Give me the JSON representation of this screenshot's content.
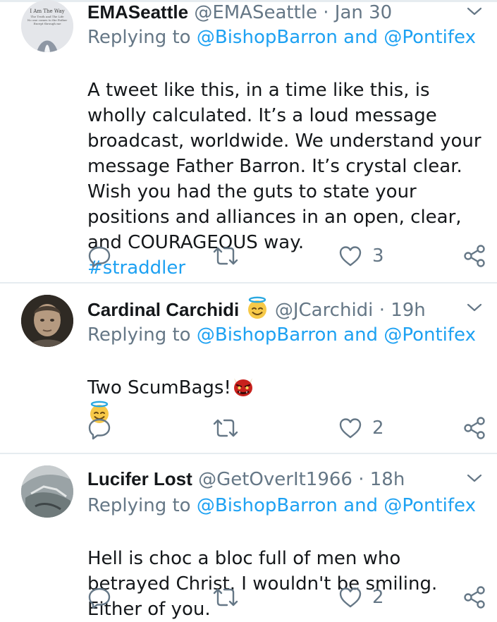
{
  "reply_prefix": "Replying to",
  "mentions": [
    "@BishopBarron",
    "@Pontifex"
  ],
  "conjunction": "and",
  "tweets": [
    {
      "name": "EMASeattle",
      "handle": "@EMASeattle",
      "separator": "·",
      "time": "Jan 30",
      "avatar_text": [
        "I Am The Way",
        "The Truth and The Life",
        "No one comes to the Father",
        "Except through me"
      ],
      "body": "A tweet like this, in a time like this, is wholly calculated. It’s a loud message broadcast, worldwide. We understand your message Father Barron. It’s crystal clear. Wish you had the guts to state your positions and alliances in an open, clear, and COURAGEOUS way.",
      "hashtag": "#straddler",
      "likes": "3"
    },
    {
      "name": "Cardinal Carchidi",
      "handle": "@JCarchidi",
      "separator": "·",
      "time": "19h",
      "body": "Two ScumBags!",
      "likes": "2"
    },
    {
      "name": "Lucifer Lost",
      "handle": "@GetOverIt1966",
      "separator": "·",
      "time": "18h",
      "body": "Hell is choc a bloc full of men who betrayed Christ. I wouldn't be smiling. Either of you.",
      "likes": "2"
    }
  ],
  "colors": {
    "accent": "#1da1f2",
    "secondary_text": "#657786",
    "primary_text": "#14171a",
    "divider": "#e6ecf0"
  },
  "icons": [
    "chevron-down-icon",
    "reply-icon",
    "retweet-icon",
    "like-icon",
    "share-icon",
    "halo-smile-emoji",
    "ogre-emoji"
  ]
}
